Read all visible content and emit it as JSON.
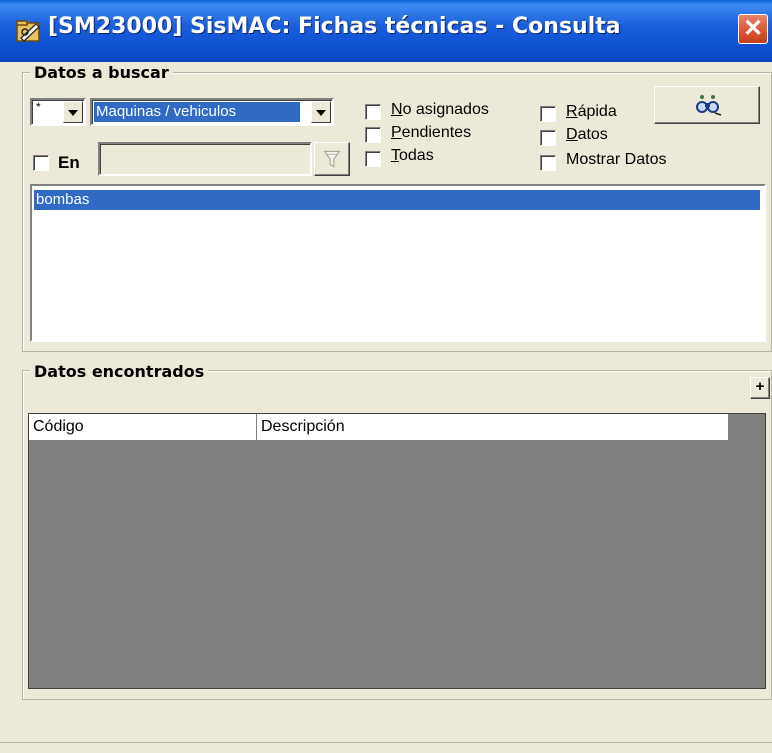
{
  "window": {
    "title": "[SM23000] SisMAC: Fichas técnicas - Consulta",
    "close_glyph": "✕"
  },
  "search": {
    "legend": "Datos a buscar",
    "prefix_combo": {
      "value": "*"
    },
    "type_combo": {
      "value": "Maquinas / vehiculos"
    },
    "en_checkbox": {
      "label": "En",
      "checked": false
    },
    "en_field": {
      "value": ""
    },
    "options": {
      "no_asignados": {
        "label": "No asignados",
        "checked": false
      },
      "pendientes": {
        "label": "Pendientes",
        "checked": false
      },
      "todas": {
        "label": "Todas",
        "checked": false
      },
      "rapida": {
        "label": "Rápida",
        "checked": false
      },
      "datos": {
        "label": "Datos",
        "checked": false
      },
      "mostrar_datos": {
        "label": "Mostrar Datos",
        "checked": false
      }
    },
    "list_items": [
      "bombas"
    ],
    "selected_index": 0
  },
  "results": {
    "legend": "Datos encontrados",
    "expand_label": "+",
    "columns": [
      "Código",
      "Descripción"
    ],
    "rows": []
  },
  "colors": {
    "titlebar": "#0a4fd0",
    "selection": "#316ac5",
    "window_bg": "#ece9d8",
    "grid_bg": "#808080",
    "close_button": "#d9532f"
  },
  "icons": {
    "app": "app-folder-icon",
    "search_button": "search-binoculars-icon",
    "filter_button": "filter-funnel-icon"
  }
}
